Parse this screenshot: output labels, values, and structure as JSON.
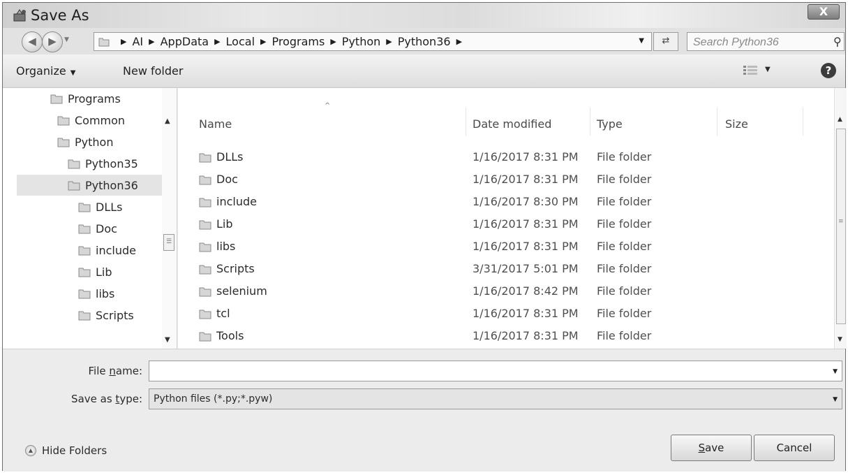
{
  "window": {
    "title": "Save As",
    "close_label": "X"
  },
  "address": {
    "crumbs": [
      "AI",
      "AppData",
      "Local",
      "Programs",
      "Python",
      "Python36"
    ],
    "search_placeholder": "Search Python36",
    "refresh_glyph": "⇄"
  },
  "toolbar": {
    "organize": "Organize",
    "new_folder": "New folder",
    "help": "?"
  },
  "navpane": {
    "items": [
      {
        "label": "Programs",
        "selected": false
      },
      {
        "label": "Common",
        "selected": false
      },
      {
        "label": "Python",
        "selected": false
      },
      {
        "label": "Python35",
        "selected": false
      },
      {
        "label": "Python36",
        "selected": true
      },
      {
        "label": "DLLs",
        "selected": false
      },
      {
        "label": "Doc",
        "selected": false
      },
      {
        "label": "include",
        "selected": false
      },
      {
        "label": "Lib",
        "selected": false
      },
      {
        "label": "libs",
        "selected": false
      },
      {
        "label": "Scripts",
        "selected": false
      }
    ]
  },
  "filelist": {
    "columns": [
      "Name",
      "Date modified",
      "Type",
      "Size"
    ],
    "rows": [
      {
        "name": "DLLs",
        "date": "1/16/2017 8:31 PM",
        "type": "File folder"
      },
      {
        "name": "Doc",
        "date": "1/16/2017 8:31 PM",
        "type": "File folder"
      },
      {
        "name": "include",
        "date": "1/16/2017 8:30 PM",
        "type": "File folder"
      },
      {
        "name": "Lib",
        "date": "1/16/2017 8:31 PM",
        "type": "File folder"
      },
      {
        "name": "libs",
        "date": "1/16/2017 8:31 PM",
        "type": "File folder"
      },
      {
        "name": "Scripts",
        "date": "3/31/2017 5:01 PM",
        "type": "File folder"
      },
      {
        "name": "selenium",
        "date": "1/16/2017 8:42 PM",
        "type": "File folder"
      },
      {
        "name": "tcl",
        "date": "1/16/2017 8:31 PM",
        "type": "File folder"
      },
      {
        "name": "Tools",
        "date": "1/16/2017 8:31 PM",
        "type": "File folder"
      }
    ]
  },
  "form": {
    "file_name_label_pre": "File ",
    "file_name_label_key": "n",
    "file_name_label_post": "ame:",
    "file_name_value": "",
    "save_type_label_pre": "Save as ",
    "save_type_label_key": "t",
    "save_type_label_post": "ype:",
    "save_type_value": "Python files (*.py;*.pyw)",
    "hide_folders": "Hide Folders",
    "save_key": "S",
    "save_rest": "ave",
    "cancel": "Cancel"
  }
}
